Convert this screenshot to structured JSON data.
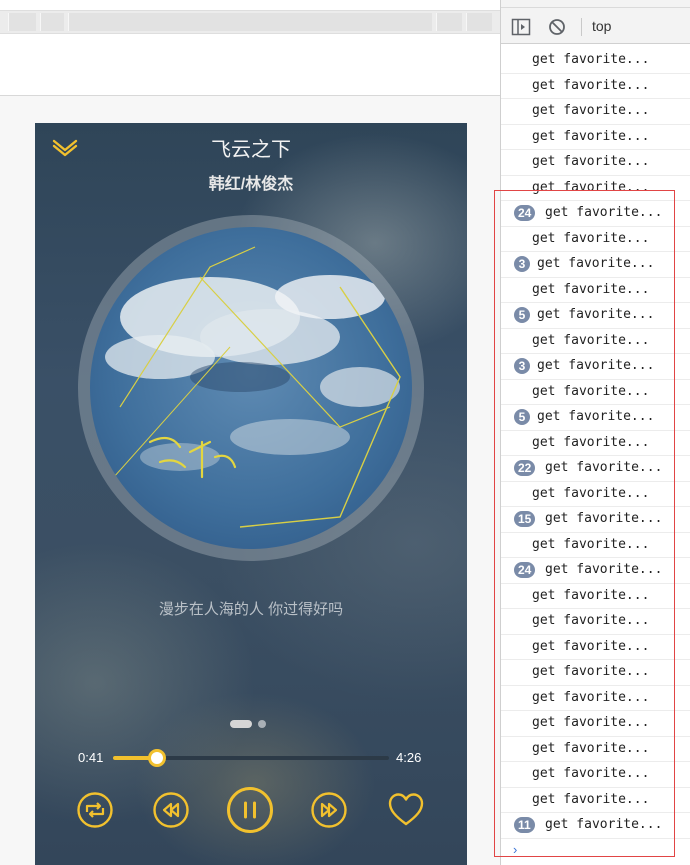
{
  "player": {
    "title": "飞云之下",
    "artist": "韩红/林俊杰",
    "lyric": "漫步在人海的人 你过得好吗",
    "current_time": "0:41",
    "total_time": "4:26",
    "progress_fraction": 0.16,
    "page_indicator": {
      "count": 2,
      "active": 0
    },
    "accent_color": "#f2c12e",
    "icons": {
      "collapse": "chevron-down-icon",
      "loop": "loop-mode-icon",
      "prev": "previous-track-icon",
      "play_pause": "pause-icon",
      "next": "next-track-icon",
      "favorite": "heart-icon"
    }
  },
  "devtools": {
    "context": "top",
    "prompt_symbol": "›",
    "messages": [
      {
        "count": null,
        "text": "get favorite..."
      },
      {
        "count": null,
        "text": "get favorite..."
      },
      {
        "count": null,
        "text": "get favorite..."
      },
      {
        "count": null,
        "text": "get favorite..."
      },
      {
        "count": null,
        "text": "get favorite..."
      },
      {
        "count": null,
        "text": "get favorite..."
      },
      {
        "count": "24",
        "text": "get favorite..."
      },
      {
        "count": null,
        "text": "get favorite..."
      },
      {
        "count": "3",
        "text": "get favorite..."
      },
      {
        "count": null,
        "text": "get favorite..."
      },
      {
        "count": "5",
        "text": "get favorite..."
      },
      {
        "count": null,
        "text": "get favorite..."
      },
      {
        "count": "3",
        "text": "get favorite..."
      },
      {
        "count": null,
        "text": "get favorite..."
      },
      {
        "count": "5",
        "text": "get favorite..."
      },
      {
        "count": null,
        "text": "get favorite..."
      },
      {
        "count": "22",
        "text": "get favorite..."
      },
      {
        "count": null,
        "text": "get favorite..."
      },
      {
        "count": "15",
        "text": "get favorite..."
      },
      {
        "count": null,
        "text": "get favorite..."
      },
      {
        "count": "24",
        "text": "get favorite..."
      },
      {
        "count": null,
        "text": "get favorite..."
      },
      {
        "count": null,
        "text": "get favorite..."
      },
      {
        "count": null,
        "text": "get favorite..."
      },
      {
        "count": null,
        "text": "get favorite..."
      },
      {
        "count": null,
        "text": "get favorite..."
      },
      {
        "count": null,
        "text": "get favorite..."
      },
      {
        "count": null,
        "text": "get favorite..."
      },
      {
        "count": null,
        "text": "get favorite..."
      },
      {
        "count": null,
        "text": "get favorite..."
      },
      {
        "count": "11",
        "text": "get favorite..."
      }
    ]
  }
}
